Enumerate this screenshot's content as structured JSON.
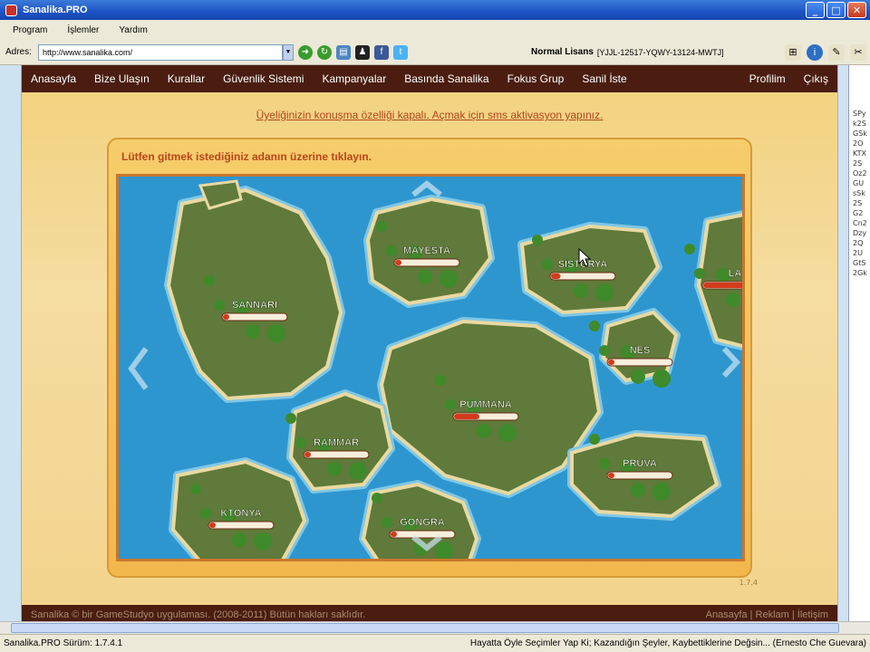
{
  "window": {
    "title": "Sanalika.PRO",
    "buttons": {
      "minimize": "_",
      "maximize": "□",
      "close": "✕"
    }
  },
  "menu": [
    "Program",
    "İşlemler",
    "Yardım"
  ],
  "address": {
    "label": "Adres:",
    "url": "http://www.sanalika.com/",
    "license_label": "Normal Lisans",
    "license_key": "[YJJL-12517-YQWY-13124-MWTJ]"
  },
  "site": {
    "nav_left": [
      "Anasayfa",
      "Bize Ulaşın",
      "Kurallar",
      "Güvenlik Sistemi",
      "Kampanyalar",
      "Basında Sanalika",
      "Fokus Grup",
      "Sanil İste"
    ],
    "nav_right": [
      "Profilim",
      "Çıkış"
    ],
    "notice": "Üyeliğinizin konuşma özelliği kapalı. Açmak için sms aktivasyon yapınız.",
    "map_prompt": "Lütfen gitmek istediğiniz adanın üzerine tıklayın.",
    "map_version": "1.7.4",
    "islands": [
      {
        "name": "SANNARI",
        "fill": 0.9
      },
      {
        "name": "MAYESTA",
        "fill": 0.9
      },
      {
        "name": "SİSTORYA",
        "fill": 0.85
      },
      {
        "name": "LA",
        "fill": 0.3
      },
      {
        "name": "NES",
        "fill": 0.9
      },
      {
        "name": "PUMMANA",
        "fill": 0.6
      },
      {
        "name": "RAMMAR",
        "fill": 0.9
      },
      {
        "name": "PRUVA",
        "fill": 0.9
      },
      {
        "name": "KTONYA",
        "fill": 0.9
      },
      {
        "name": "GONGRA",
        "fill": 0.9
      }
    ],
    "footer_left": "Sanalika © bir GameStudyo uygulaması. (2008-2011) Bütün hakları saklıdır.",
    "footer_right": "Anasayfa | Reklam | İletişim"
  },
  "side_letters": "SPyk2SGSk2OKTX2SOz2GUsSk2SG2Cn2Dzy2Q2UGtS2Gk",
  "status": {
    "version": "Sanalika.PRO Sürüm: 1.7.4.1",
    "quote": "Hayatta Öyle Seçimler Yap Ki; Kazandığın Şeyler, Kaybettiklerine Değsin... (Ernesto Che Guevara)"
  },
  "colors": {
    "sea": "#2e96cf",
    "land": "#5f7a3a",
    "shore": "#e9d9a2",
    "nav": "#4a1d10",
    "accent": "#b8471c"
  }
}
